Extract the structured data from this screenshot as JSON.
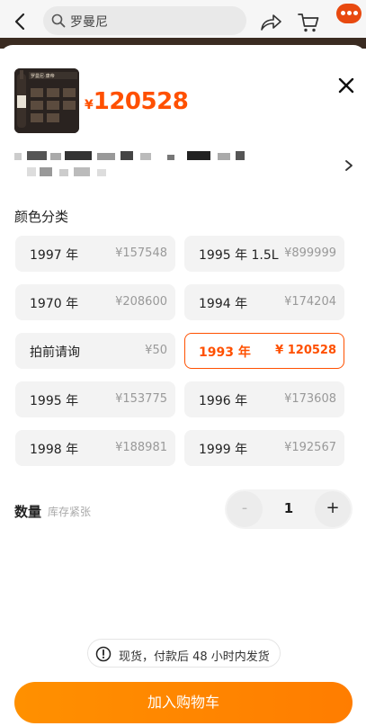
{
  "header": {
    "search_text": "罗曼尼"
  },
  "product": {
    "thumbnail_text": "罗曼尼·康帝Romanee-Conti",
    "price_symbol": "¥",
    "price": "120528"
  },
  "variants": {
    "title": "颜色分类",
    "options": [
      {
        "label": "1997 年",
        "price": "¥157548",
        "selected": false
      },
      {
        "label": "1995 年 1.5L",
        "price": "¥899999",
        "selected": false
      },
      {
        "label": "1970 年",
        "price": "¥208600",
        "selected": false
      },
      {
        "label": "1994 年",
        "price": "¥174204",
        "selected": false
      },
      {
        "label": "拍前请询",
        "price": "¥50",
        "selected": false
      },
      {
        "label": "1993 年",
        "price": "¥ 120528",
        "selected": true
      },
      {
        "label": "1995 年",
        "price": "¥153775",
        "selected": false
      },
      {
        "label": "1996 年",
        "price": "¥173608",
        "selected": false
      },
      {
        "label": "1998 年",
        "price": "¥188981",
        "selected": false
      },
      {
        "label": "1999 年",
        "price": "¥192567",
        "selected": false
      }
    ]
  },
  "quantity": {
    "label": "数量",
    "hint": "库存紧张",
    "minus": "-",
    "value": "1",
    "plus": "+"
  },
  "notice": {
    "text": "现货，付款后 48 小时内发货"
  },
  "footer": {
    "add_to_cart": "加入购物车"
  },
  "colors": {
    "accent": "#ff5000",
    "button": "#ff8a00"
  }
}
